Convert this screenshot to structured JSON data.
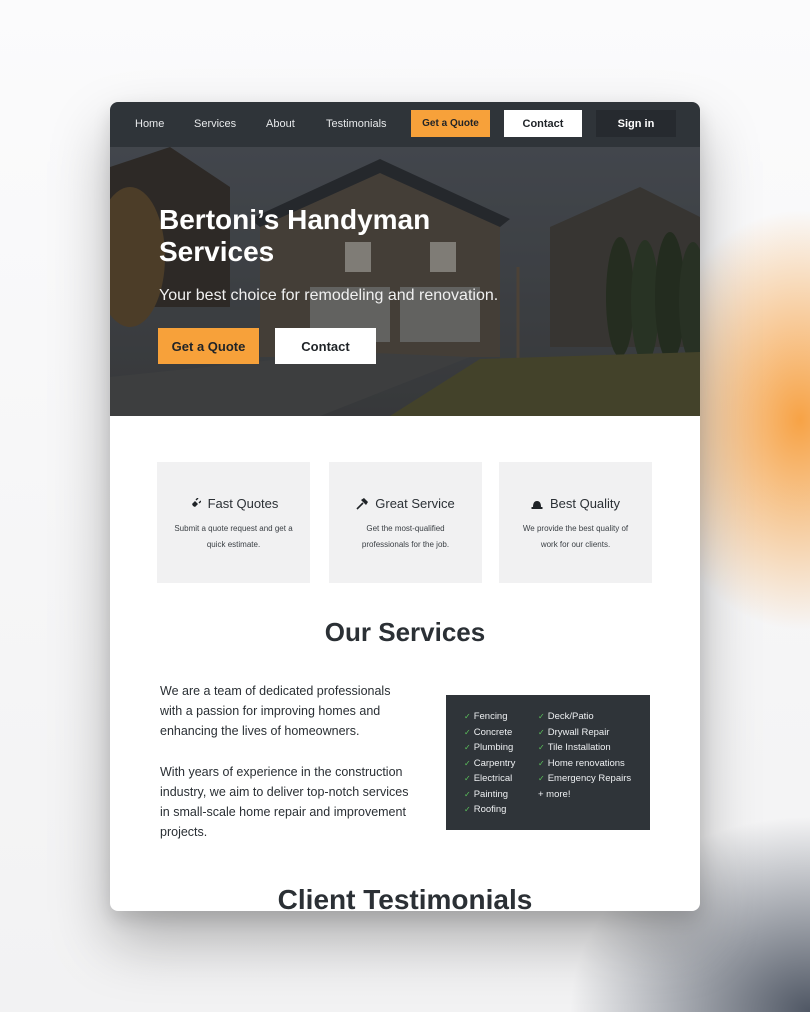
{
  "nav": {
    "links": [
      "Home",
      "Services",
      "About",
      "Testimonials"
    ],
    "quote_label": "Get a Quote",
    "contact_label": "Contact",
    "signin_label": "Sign in"
  },
  "hero": {
    "title": "Bertoni’s Handyman Services",
    "subtitle": "Your best choice for remodeling and renovation.",
    "quote_label": "Get a Quote",
    "contact_label": "Contact"
  },
  "features": [
    {
      "icon": "plug-icon",
      "title": "Fast Quotes",
      "desc": "Submit a quote request and get a quick estimate."
    },
    {
      "icon": "hammer-icon",
      "title": "Great Service",
      "desc": "Get the most-qualified professionals for the job."
    },
    {
      "icon": "hard-hat-icon",
      "title": "Best Quality",
      "desc": "We provide the best quality of work for our clients."
    }
  ],
  "services": {
    "title": "Our Services",
    "para1": "We are a team of dedicated professionals with a passion for improving homes and enhancing the lives of homeowners.",
    "para2": "With years of experience in the construction industry, we aim to deliver top-notch services in small-scale home repair and improvement projects.",
    "list_left": [
      "Fencing",
      "Concrete",
      "Plumbing",
      "Carpentry",
      "Electrical",
      "Painting",
      "Roofing"
    ],
    "list_right": [
      "Deck/Patio",
      "Drywall Repair",
      "Tile Installation",
      "Home renovations",
      "Emergency Repairs"
    ],
    "more": "+ more!"
  },
  "testimonials": {
    "title": "Client Testimonials"
  },
  "colors": {
    "accent": "#f7a13a",
    "dark": "#2f3439",
    "check": "#5cc45c"
  }
}
